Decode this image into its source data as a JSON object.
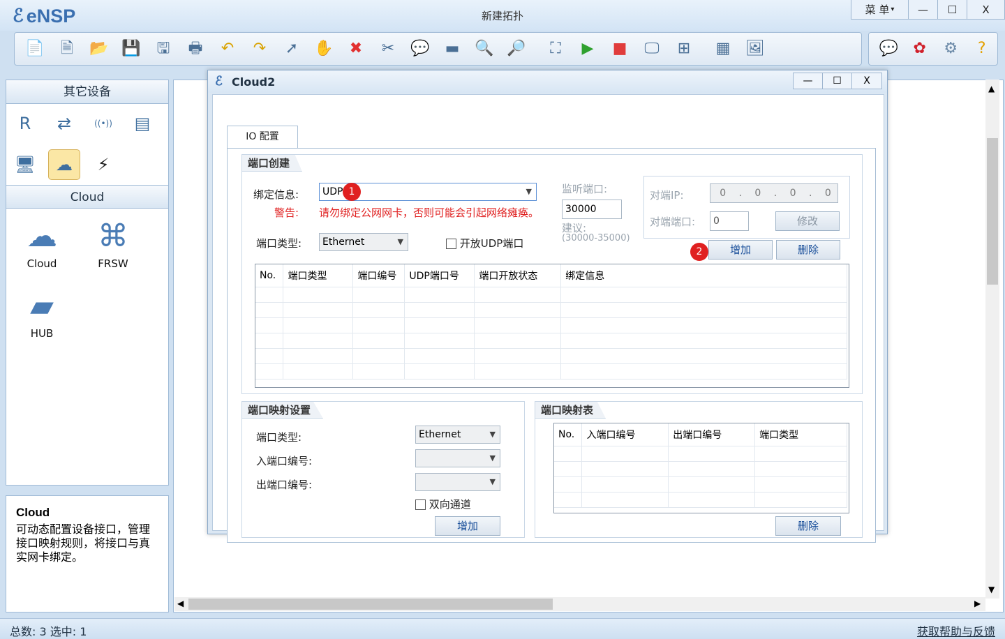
{
  "app": {
    "logo_text": "eNSP",
    "title": "新建拓扑",
    "menu_label": "菜 单",
    "minimize": "—",
    "maximize": "☐",
    "close": "X"
  },
  "toolbar": {
    "items": [
      {
        "icon": "new-file-icon",
        "glyph": "📄"
      },
      {
        "icon": "new-topology-icon",
        "glyph": "🗎"
      },
      {
        "icon": "open-folder-icon",
        "glyph": "📂"
      },
      {
        "icon": "save-icon",
        "glyph": "💾"
      },
      {
        "icon": "save-as-icon",
        "glyph": "🖫"
      },
      {
        "icon": "print-icon",
        "glyph": "🖶"
      },
      {
        "icon": "undo-icon",
        "glyph": "↶"
      },
      {
        "icon": "redo-icon",
        "glyph": "↷"
      },
      {
        "icon": "select-pointer-icon",
        "glyph": "➚"
      },
      {
        "icon": "pan-hand-icon",
        "glyph": "✋"
      },
      {
        "icon": "delete-icon",
        "glyph": "✖"
      },
      {
        "icon": "delete-link-icon",
        "glyph": "✂"
      },
      {
        "icon": "text-comment-icon",
        "glyph": "💬"
      },
      {
        "icon": "rectangle-icon",
        "glyph": "▬"
      },
      {
        "icon": "zoom-in-icon",
        "glyph": "🔍"
      },
      {
        "icon": "zoom-out-icon",
        "glyph": "🔎"
      },
      {
        "icon": "fit-view-icon",
        "glyph": "⛶"
      },
      {
        "icon": "start-device-icon",
        "glyph": "▶"
      },
      {
        "icon": "stop-device-icon",
        "glyph": "■"
      },
      {
        "icon": "capture-icon",
        "glyph": "🖵"
      },
      {
        "icon": "topology-icon",
        "glyph": "⊞"
      },
      {
        "icon": "grid-icon",
        "glyph": "▦"
      },
      {
        "icon": "screenshot-icon",
        "glyph": "🖼"
      }
    ],
    "right_items": [
      {
        "icon": "chat-icon",
        "glyph": "💬"
      },
      {
        "icon": "huawei-icon",
        "glyph": "✿"
      },
      {
        "icon": "settings-gear-icon",
        "glyph": "⚙"
      },
      {
        "icon": "help-icon",
        "glyph": "?"
      }
    ],
    "colors": {
      "play": "#2fa12f",
      "stop": "#e03c3c",
      "delete": "#e23030",
      "undo": "#d9a200"
    }
  },
  "sidebar": {
    "other_devices_title": "其它设备",
    "category_icons": [
      {
        "name": "router-icon",
        "glyph": "R"
      },
      {
        "name": "switch-icon",
        "glyph": "⇄"
      },
      {
        "name": "wireless-icon",
        "glyph": "((•))"
      },
      {
        "name": "firewall-icon",
        "glyph": "▤"
      },
      {
        "name": "pc-icon",
        "glyph": "🖥"
      },
      {
        "name": "cloud-icon",
        "glyph": "☁"
      },
      {
        "name": "power-icon",
        "glyph": "⚡"
      }
    ],
    "section_title": "Cloud",
    "devices": [
      {
        "label": "Cloud",
        "icon": "cloud-device-icon"
      },
      {
        "label": "FRSW",
        "icon": "frsw-device-icon"
      },
      {
        "label": "HUB",
        "icon": "hub-device-icon"
      }
    ],
    "desc_title": "Cloud",
    "desc_text": "可动态配置设备接口，管理接口映射规则，将接口与真实网卡绑定。"
  },
  "status": {
    "left": "总数: 3  选中: 1",
    "right": "获取帮助与反馈"
  },
  "dialog": {
    "title": "Cloud2",
    "tab_label": "IO 配置",
    "port_create": {
      "header": "端口创建",
      "bind_label": "绑定信息:",
      "bind_value": "UDP",
      "warn_label": "警告:",
      "warn_text": "请勿绑定公网网卡，否则可能会引起网络瘫痪。",
      "port_type_label": "端口类型:",
      "port_type_value": "Ethernet",
      "open_udp_label": "开放UDP端口",
      "listen_label": "监听端口:",
      "listen_value": "30000",
      "suggest_label": "建议:",
      "suggest_range": "(30000-35000)",
      "peer_ip_label": "对端IP:",
      "peer_ip_value": [
        "0",
        "0",
        "0",
        "0"
      ],
      "peer_port_label": "对端端口:",
      "peer_port_value": "0",
      "modify_btn": "修改",
      "add_btn": "增加",
      "delete_btn": "删除",
      "badge1": "1",
      "badge2": "2",
      "columns": [
        "No.",
        "端口类型",
        "端口编号",
        "UDP端口号",
        "端口开放状态",
        "绑定信息"
      ]
    },
    "mapping_settings": {
      "header": "端口映射设置",
      "port_type_label": "端口类型:",
      "port_type_value": "Ethernet",
      "in_port_label": "入端口编号:",
      "out_port_label": "出端口编号:",
      "bidirectional_label": "双向通道",
      "add_btn": "增加"
    },
    "mapping_table": {
      "header": "端口映射表",
      "columns": [
        "No.",
        "入端口编号",
        "出端口编号",
        "端口类型"
      ],
      "delete_btn": "删除"
    }
  }
}
